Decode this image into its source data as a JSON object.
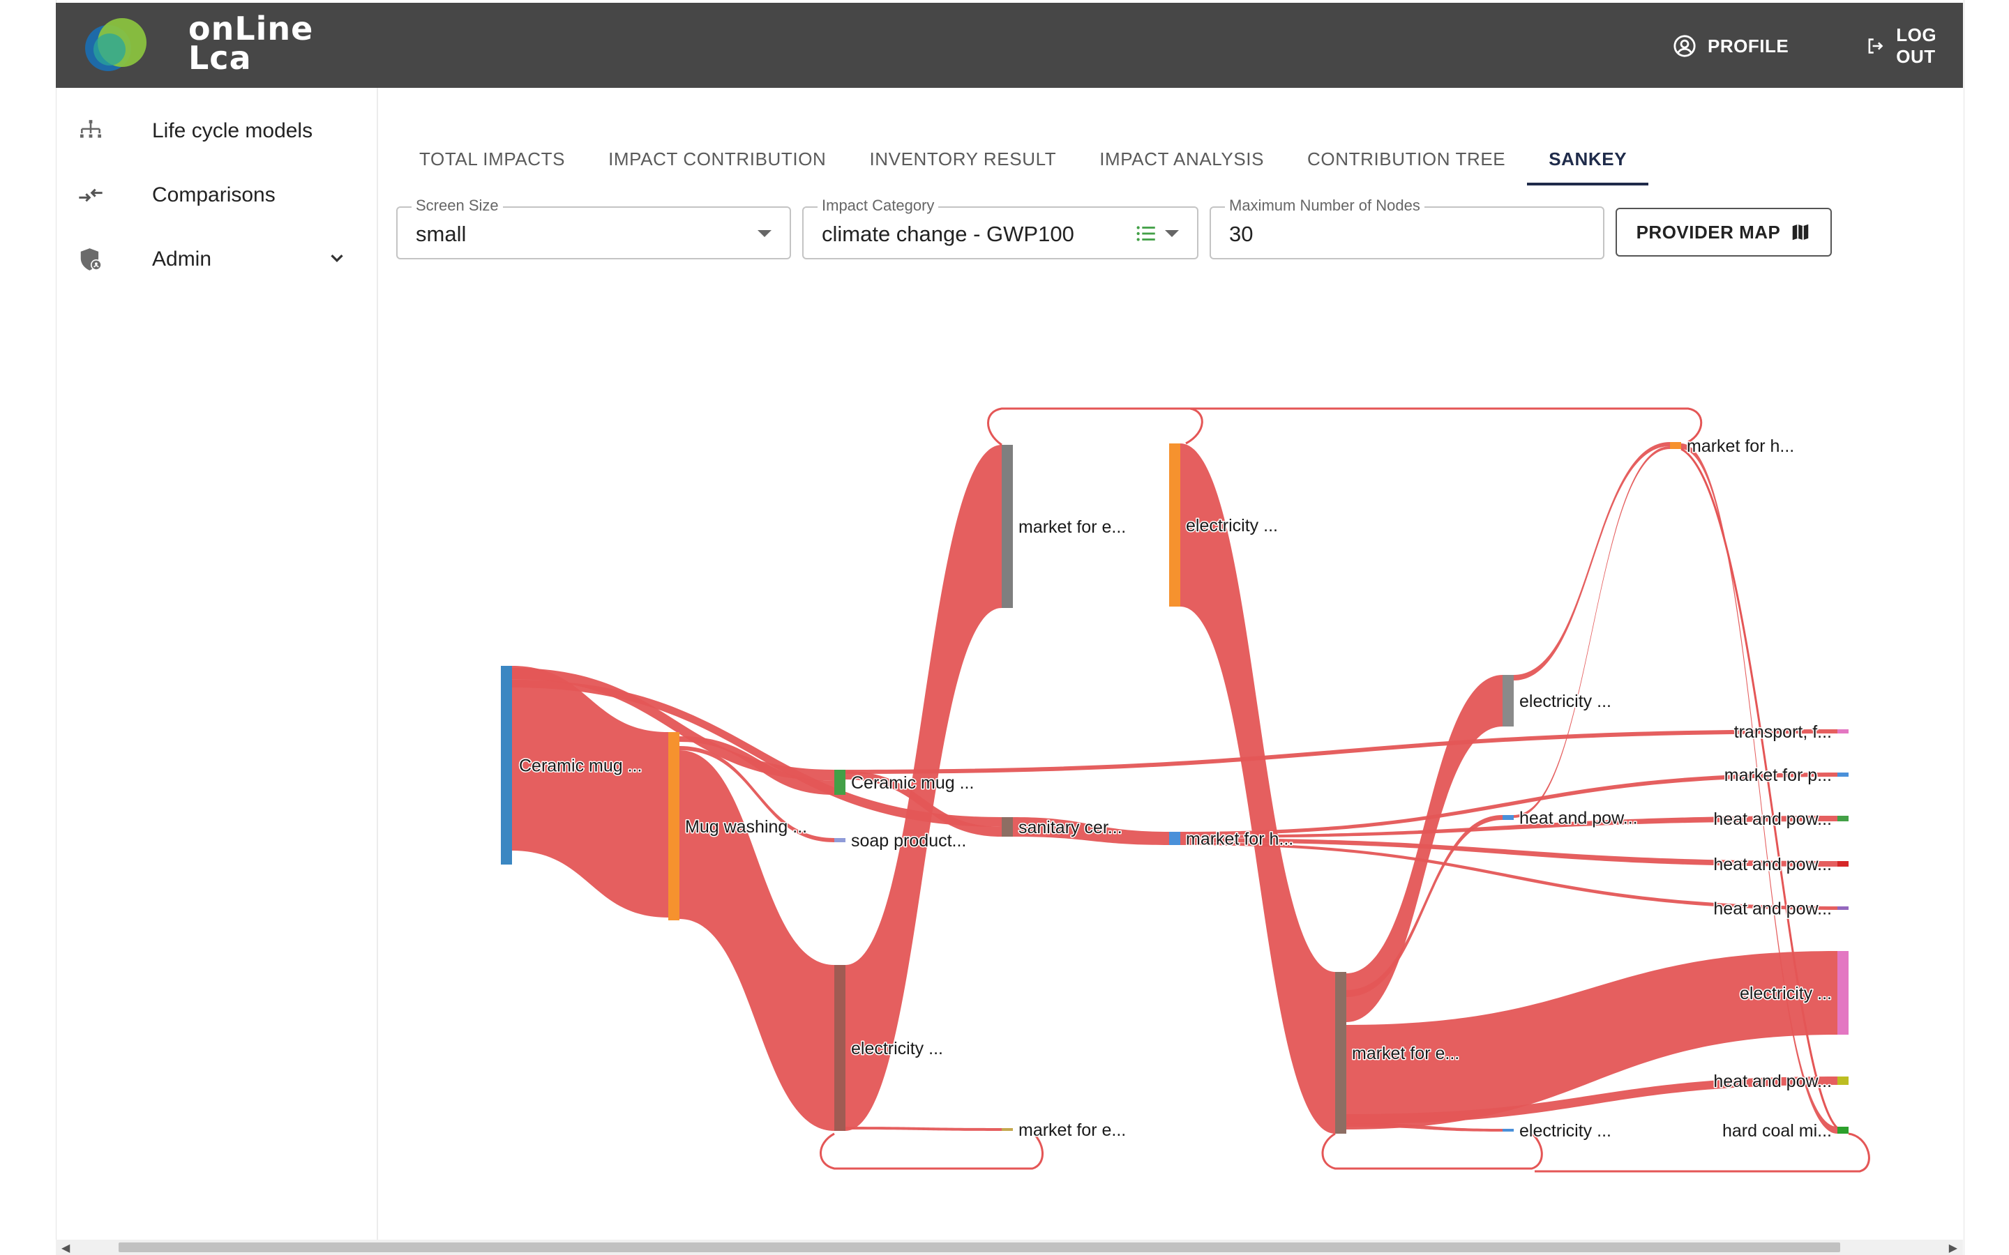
{
  "app": {
    "logo_line1": "onLine",
    "logo_line2": "Lca",
    "profile_label": "PROFILE",
    "logout_label": "LOG OUT"
  },
  "sidebar": {
    "items": [
      {
        "label": "Life cycle models",
        "icon": "hierarchy-icon"
      },
      {
        "label": "Comparisons",
        "icon": "compare-arrows-icon"
      },
      {
        "label": "Admin",
        "icon": "admin-shield-icon"
      }
    ]
  },
  "tabs": [
    {
      "label": "TOTAL IMPACTS",
      "active": false
    },
    {
      "label": "IMPACT CONTRIBUTION",
      "active": false
    },
    {
      "label": "INVENTORY RESULT",
      "active": false
    },
    {
      "label": "IMPACT ANALYSIS",
      "active": false
    },
    {
      "label": "CONTRIBUTION TREE",
      "active": false
    },
    {
      "label": "SANKEY",
      "active": true
    }
  ],
  "controls": {
    "screen_size": {
      "label": "Screen Size",
      "value": "small"
    },
    "impact_category": {
      "label": "Impact Category",
      "value": "climate change - GWP100"
    },
    "max_nodes": {
      "label": "Maximum Number of Nodes",
      "value": "30"
    },
    "provider_map_label": "PROVIDER MAP"
  },
  "sankey": {
    "link_color": "#e45656",
    "nodes": [
      {
        "label": "Ceramic mug ...",
        "color": "#3b87c2"
      },
      {
        "label": "Mug washing ...",
        "color": "#f6922e"
      },
      {
        "label": "Ceramic mug ...",
        "color": "#43a047"
      },
      {
        "label": "soap product...",
        "color": "#8f9bd8"
      },
      {
        "label": "electricity ...",
        "color": "#a05b53"
      },
      {
        "label": "market for e...",
        "color": "#7f7f7f"
      },
      {
        "label": "sanitary cer...",
        "color": "#8d6e63"
      },
      {
        "label": "market for e...",
        "color": "#c4a84f"
      },
      {
        "label": "electricity ...",
        "color": "#f6922e"
      },
      {
        "label": "market for h...",
        "color": "#4a90d9"
      },
      {
        "label": "market for e...",
        "color": "#8d6e63"
      },
      {
        "label": "electricity ...",
        "color": "#8a8a8a"
      },
      {
        "label": "heat and pow...",
        "color": "#4a90d9"
      },
      {
        "label": "electricity ...",
        "color": "#4a90d9"
      },
      {
        "label": "market for h...",
        "color": "#f6922e"
      },
      {
        "label": "transport, f...",
        "color": "#e377c2"
      },
      {
        "label": "market for p...",
        "color": "#4a90d9"
      },
      {
        "label": "heat and pow...",
        "color": "#43a047"
      },
      {
        "label": "heat and pow...",
        "color": "#d62728"
      },
      {
        "label": "heat and pow...",
        "color": "#9467bd"
      },
      {
        "label": "electricity ...",
        "color": "#e377c2"
      },
      {
        "label": "heat and pow...",
        "color": "#bcbd22"
      },
      {
        "label": "hard coal mi...",
        "color": "#2ca02c"
      }
    ]
  }
}
